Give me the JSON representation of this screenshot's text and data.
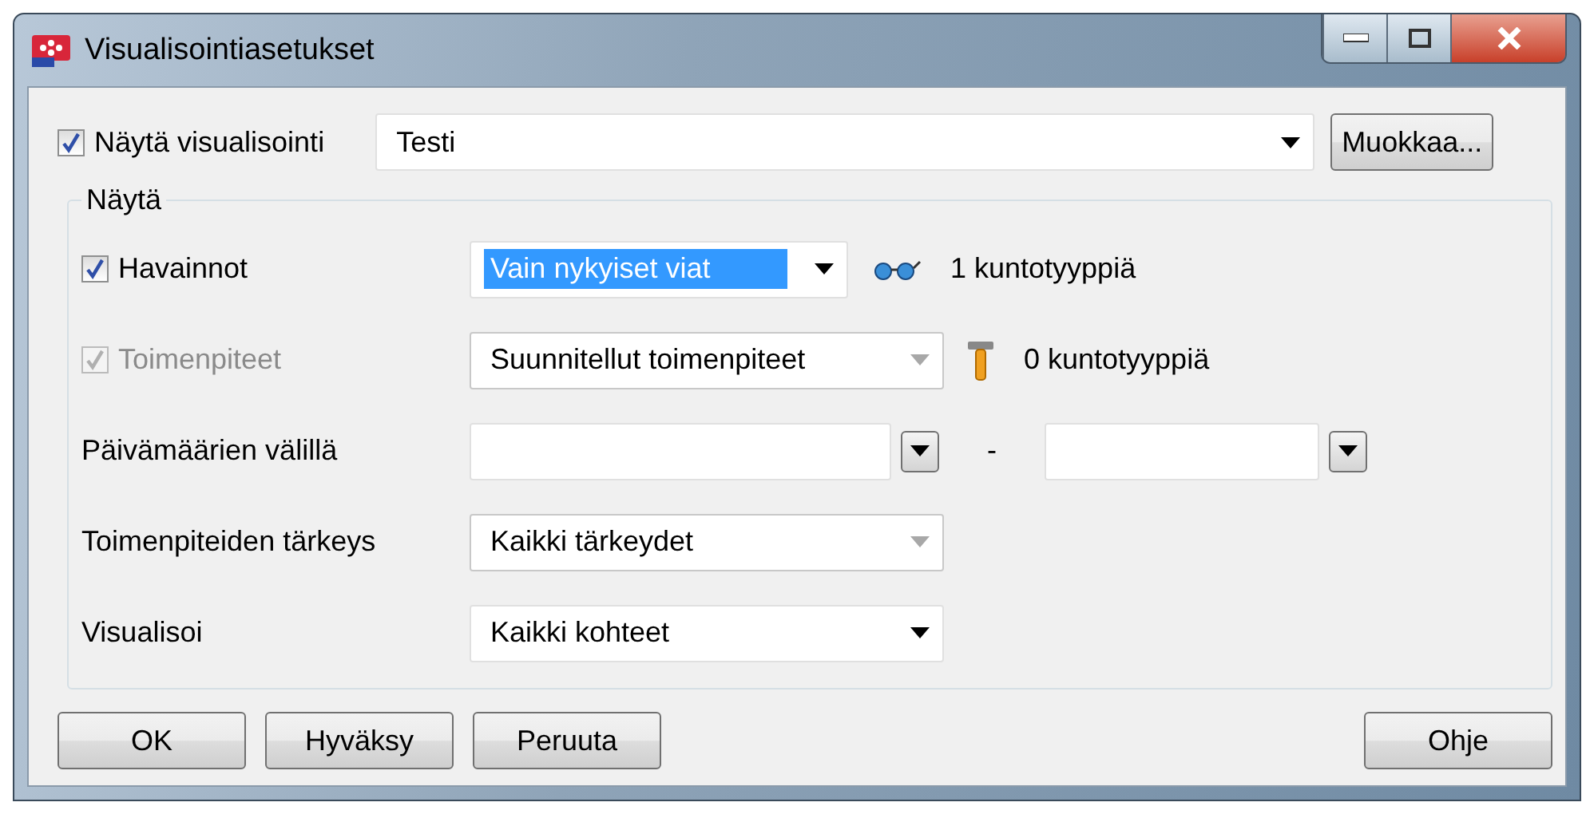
{
  "window": {
    "title": "Visualisointiasetukset"
  },
  "show_visualization": {
    "label": "Näytä visualisointi",
    "checked": true,
    "value": "Testi",
    "edit_button": "Muokkaa..."
  },
  "group": {
    "title": "Näytä",
    "rows": [
      {
        "kind": "checkbox",
        "label": "Havainnot",
        "checked": true,
        "disabled": false,
        "control": {
          "kind": "combo",
          "value": "Vain nykyiset viat",
          "disabled": false,
          "highlighted": true,
          "wide": false
        },
        "info": {
          "kind": "glasses",
          "text": "1 kuntotyyppiä"
        }
      },
      {
        "kind": "checkbox",
        "label": "Toimenpiteet",
        "checked": true,
        "disabled": true,
        "control": {
          "kind": "combo",
          "value": "Suunnitellut toimenpiteet",
          "disabled": true,
          "highlighted": false,
          "wide": true
        },
        "info": {
          "kind": "hammer",
          "text": "0 kuntotyyppiä"
        }
      },
      {
        "kind": "label",
        "label": "Päivämäärien välillä",
        "control": {
          "kind": "daterange",
          "separator": "-"
        }
      },
      {
        "kind": "label",
        "label": "Toimenpiteiden tärkeys",
        "control": {
          "kind": "combo",
          "value": "Kaikki tärkeydet",
          "disabled": true,
          "highlighted": false,
          "wide": true
        }
      },
      {
        "kind": "label",
        "label": "Visualisoi",
        "control": {
          "kind": "combo",
          "value": "Kaikki kohteet",
          "disabled": false,
          "highlighted": false,
          "wide": true
        }
      }
    ]
  },
  "buttons_left": [
    "OK",
    "Hyväksy",
    "Peruuta"
  ],
  "buttons_right": [
    "Ohje"
  ]
}
